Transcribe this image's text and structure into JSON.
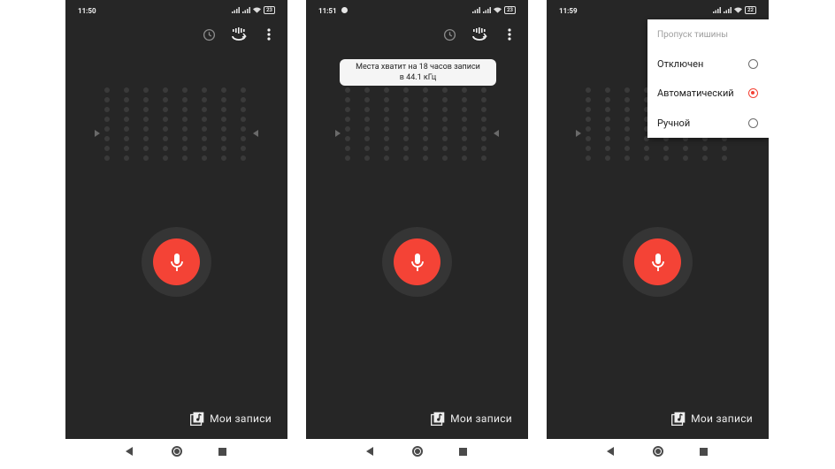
{
  "screens": [
    {
      "status": {
        "time": "11:50",
        "battery": "23"
      },
      "toolbar": {
        "icons": [
          "history-icon",
          "sound-wave-icon",
          "more-vert-icon"
        ]
      },
      "bottom": {
        "my_recordings": "Мои записи"
      }
    },
    {
      "status": {
        "time": "11:51",
        "battery": "23"
      },
      "toolbar": {
        "icons": [
          "history-icon",
          "sound-wave-icon",
          "more-vert-icon"
        ]
      },
      "toast": {
        "line1": "Места хватит на 18 часов записи",
        "line2": "в 44.1 кГц"
      },
      "bottom": {
        "my_recordings": "Мои записи"
      }
    },
    {
      "status": {
        "time": "11:59",
        "battery": "22"
      },
      "popup": {
        "title": "Пропуск тишины",
        "options": [
          {
            "label": "Отключен",
            "selected": false
          },
          {
            "label": "Автоматический",
            "selected": true
          },
          {
            "label": "Ручной",
            "selected": false
          }
        ]
      },
      "bottom": {
        "my_recordings": "Мои записи"
      }
    }
  ],
  "colors": {
    "background": "#262626",
    "record_red": "#f44336",
    "ring": "#353535",
    "dots": "#3a3a3a"
  },
  "navbar_icons": [
    "back-icon",
    "home-icon",
    "recents-icon"
  ]
}
